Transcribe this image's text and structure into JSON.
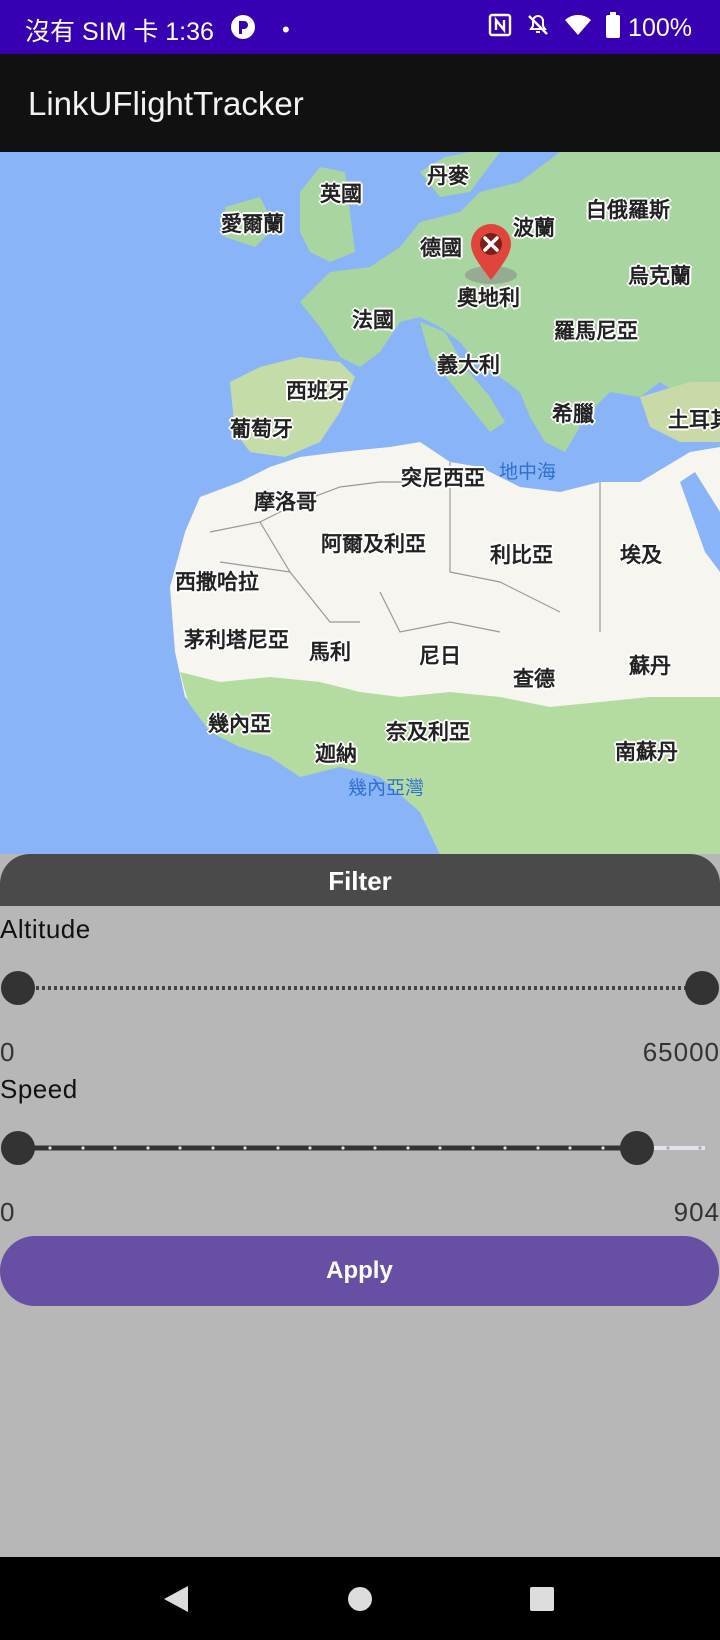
{
  "status_bar": {
    "carrier_time": "沒有 SIM 卡 1:36",
    "dot": "•",
    "battery": "100%",
    "icons": [
      "app-notification-icon",
      "nfc-icon",
      "mute-icon",
      "wifi-icon",
      "battery-icon"
    ]
  },
  "app_bar": {
    "title": "LinkUFlightTracker"
  },
  "map": {
    "countries": [
      "丹麥",
      "英國",
      "愛爾蘭",
      "白俄羅斯",
      "德國",
      "波蘭",
      "烏克蘭",
      "奧地利",
      "法國",
      "羅馬尼亞",
      "義大利",
      "西班牙",
      "葡萄牙",
      "希臘",
      "土耳其",
      "突尼西亞",
      "摩洛哥",
      "阿爾及利亞",
      "利比亞",
      "埃及",
      "西撒哈拉",
      "茅利塔尼亞",
      "馬利",
      "尼日",
      "查德",
      "蘇丹",
      "幾內亞",
      "奈及利亞",
      "迦納",
      "南蘇丹"
    ],
    "seas": [
      "地中海",
      "幾內亞灣"
    ],
    "marker_icon": "flight-marker-icon",
    "colors": {
      "ocean": "#8ab4f8",
      "land_green": "#a8d5a0",
      "desert": "#f7f5f0",
      "marker": "#e0443a"
    }
  },
  "filter": {
    "title": "Filter",
    "altitude": {
      "label": "Altitude",
      "min_label": "0",
      "max_label": "65000",
      "selected_min": 0,
      "selected_max": 65000
    },
    "speed": {
      "label": "Speed",
      "min_label": "0",
      "max_label": "904",
      "selected_min": 0,
      "selected_max": 904,
      "fill_fraction": 0.9
    },
    "apply_label": "Apply",
    "colors": {
      "header": "#4a4a4a",
      "panel": "#b7b7b7",
      "button": "#6750a4"
    }
  },
  "nav_bar": {
    "back_icon": "back-triangle-icon",
    "home_icon": "home-circle-icon",
    "recents_icon": "recents-square-icon"
  }
}
